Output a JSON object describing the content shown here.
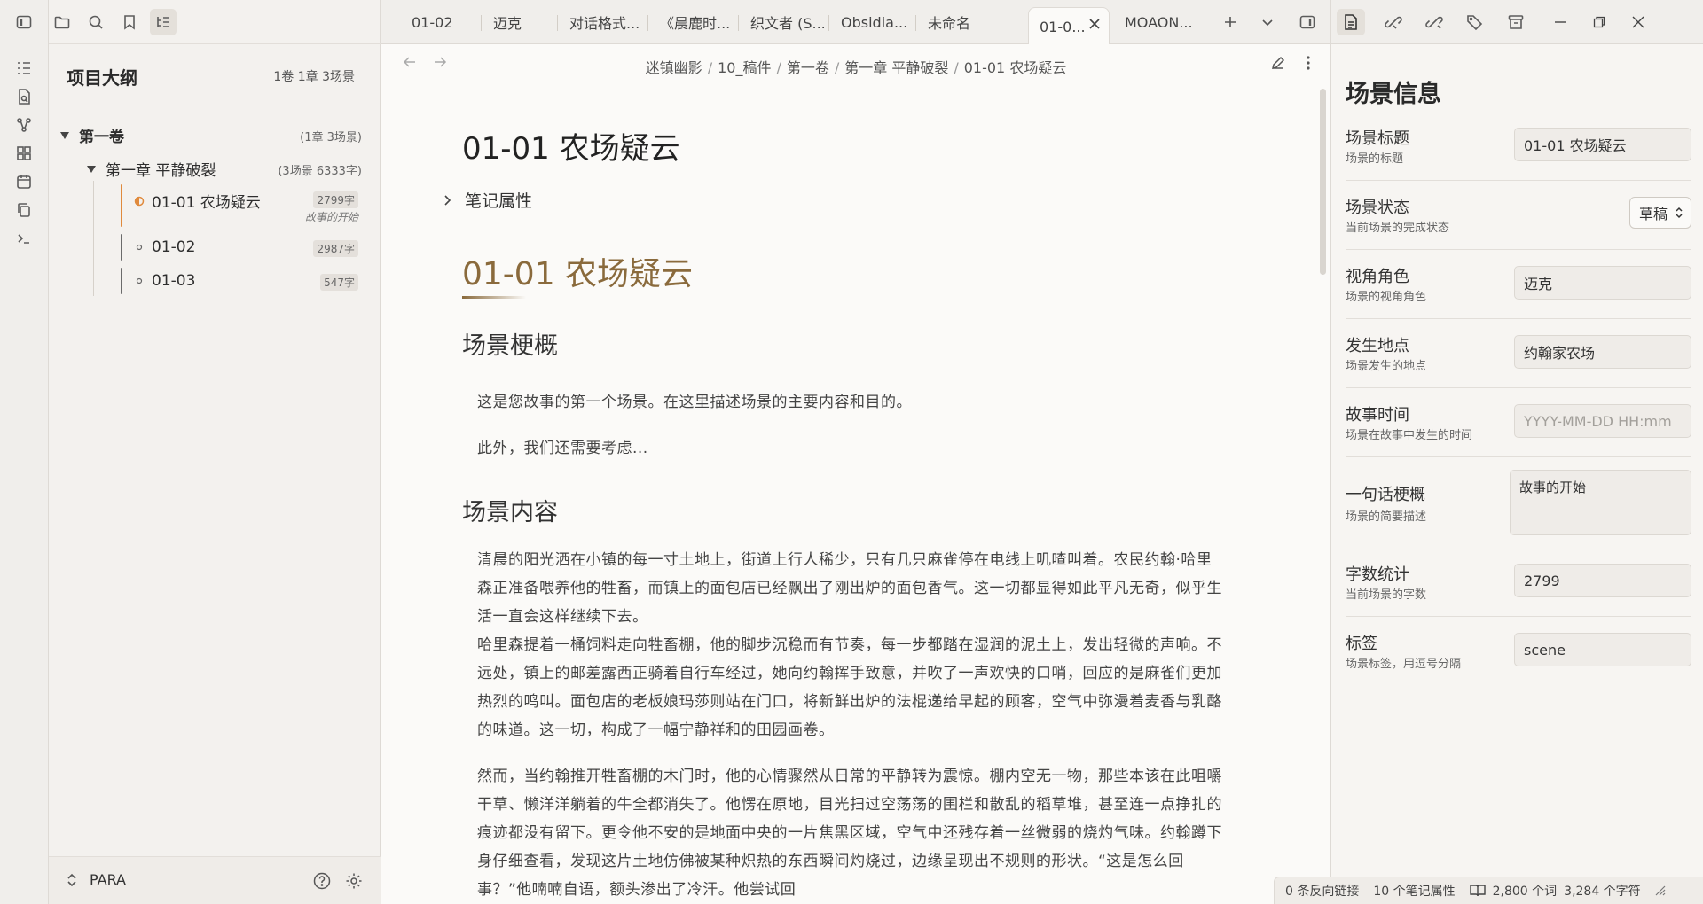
{
  "left_sidebar": {
    "outline_title": "项目大纲",
    "outline_summary": "1卷 1章 3场景",
    "volume": {
      "label": "第一卷",
      "meta": "(1章 3场景)"
    },
    "chapter": {
      "label": "第一章 平静破裂",
      "meta": "(3场景 6333字)"
    },
    "scenes": [
      {
        "label": "01-01 农场疑云",
        "words": "2799字",
        "subtitle": "故事的开始",
        "status": "in-progress"
      },
      {
        "label": "01-02",
        "words": "2987字",
        "subtitle": "",
        "status": "empty"
      },
      {
        "label": "01-03",
        "words": "547字",
        "subtitle": "",
        "status": "empty"
      }
    ],
    "vault_name": "PARA"
  },
  "tabs": [
    {
      "label": "01-02"
    },
    {
      "label": "迈克"
    },
    {
      "label": "对话格式..."
    },
    {
      "label": "《晨鹿时..."
    },
    {
      "label": "织文者 (S..."
    },
    {
      "label": "Obsidia..."
    },
    {
      "label": "未命名"
    },
    {
      "label": "01-0...",
      "active": true
    },
    {
      "label": "MOAON..."
    }
  ],
  "editor": {
    "breadcrumb": [
      "迷镇幽影",
      "10_稿件",
      "第一卷",
      "第一章 平静破裂",
      "01-01 农场疑云"
    ],
    "inline_title": "01-01 农场疑云",
    "properties_label": "笔记属性",
    "h1": "01-01 农场疑云",
    "section1_heading": "场景梗概",
    "section1_paragraphs": [
      "这是您故事的第一个场景。在这里描述场景的主要内容和目的。",
      "此外，我们还需要考虑..."
    ],
    "section2_heading": "场景内容",
    "content_paragraph1": "清晨的阳光洒在小镇的每一寸土地上，街道上行人稀少，只有几只麻雀停在电线上叽喳叫着。农民约翰·哈里森正准备喂养他的牲畜，而镇上的面包店已经飘出了刚出炉的面包香气。这一切都显得如此平凡无奇，似乎生活一直会这样继续下去。",
    "content_paragraph2": "哈里森提着一桶饲料走向牲畜棚，他的脚步沉稳而有节奏，每一步都踏在湿润的泥土上，发出轻微的声响。不远处，镇上的邮差露西正骑着自行车经过，她向约翰挥手致意，并吹了一声欢快的口哨，回应的是麻雀们更加热烈的鸣叫。面包店的老板娘玛莎则站在门口，将新鲜出炉的法棍递给早起的顾客，空气中弥漫着麦香与乳酪的味道。这一切，构成了一幅宁静祥和的田园画卷。",
    "content_paragraph3": "然而，当约翰推开牲畜棚的木门时，他的心情骤然从日常的平静转为震惊。棚内空无一物，那些本该在此咀嚼干草、懒洋洋躺着的牛全都消失了。他愣在原地，目光扫过空荡荡的围栏和散乱的稻草堆，甚至连一点挣扎的痕迹都没有留下。更令他不安的是地面中央的一片焦黑区域，空气中还残存着一丝微弱的烧灼气味。约翰蹲下身仔细查看，发现这片土地仿佛被某种炽热的东西瞬间灼烧过，边缘呈现出不规则的形状。“这是怎么回事？”他喃喃自语，额头渗出了冷汗。他尝试回"
  },
  "scene_panel": {
    "title": "场景信息",
    "fields": [
      {
        "label": "场景标题",
        "desc": "场景的标题",
        "value": "01-01 农场疑云",
        "placeholder": ""
      },
      {
        "label": "场景状态",
        "desc": "当前场景的完成状态",
        "value": "草稿",
        "placeholder": ""
      },
      {
        "label": "视角角色",
        "desc": "场景的视角角色",
        "value": "迈克",
        "placeholder": ""
      },
      {
        "label": "发生地点",
        "desc": "场景发生的地点",
        "value": "约翰家农场",
        "placeholder": ""
      },
      {
        "label": "故事时间",
        "desc": "场景在故事中发生的时间",
        "value": "",
        "placeholder": "YYYY-MM-DD HH:mm"
      },
      {
        "label": "一句话梗概",
        "desc": "场景的简要描述",
        "value": "故事的开始",
        "placeholder": ""
      },
      {
        "label": "字数统计",
        "desc": "当前场景的字数",
        "value": "2799",
        "placeholder": ""
      },
      {
        "label": "标签",
        "desc": "场景标签，用逗号分隔",
        "value": "scene",
        "placeholder": ""
      }
    ]
  },
  "status_bar": {
    "backlinks": "0 条反向链接",
    "properties": "10 个笔记属性",
    "words": "2,800 个词",
    "chars": "3,284 个字符"
  },
  "colors": {
    "accent_heading": "#8a6a3c",
    "active_scene": "#e08a3c",
    "background": "#fbfaf8",
    "sidebar": "#f3f1ee"
  }
}
